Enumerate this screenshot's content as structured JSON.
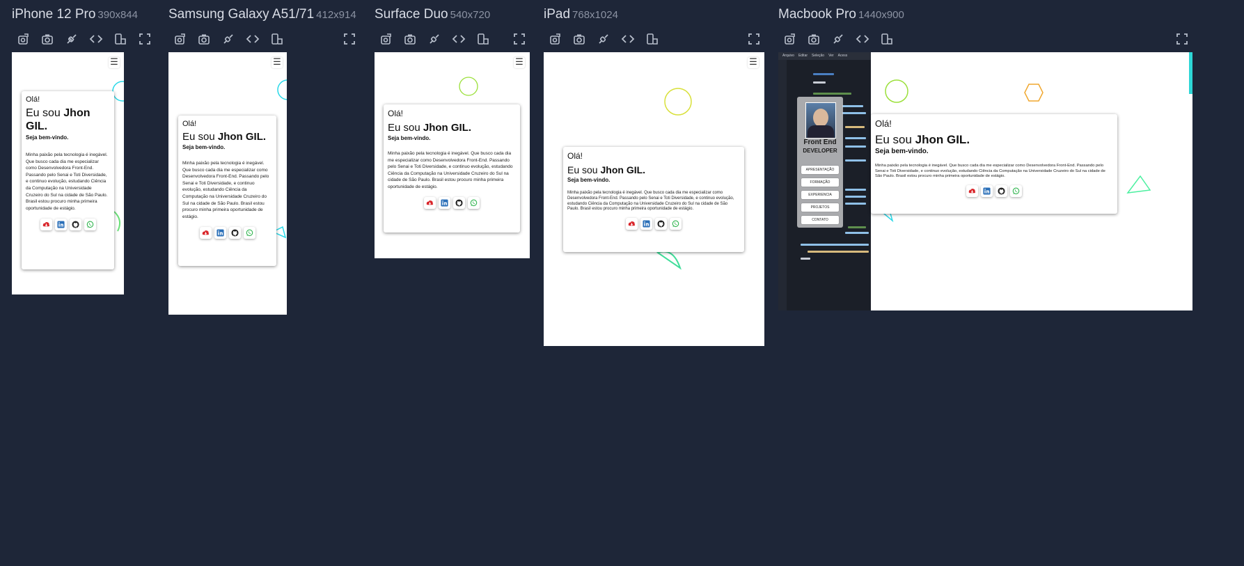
{
  "devices": [
    {
      "name": "iPhone 12 Pro",
      "size": "390x844"
    },
    {
      "name": "Samsung Galaxy A51/71",
      "size": "412x914"
    },
    {
      "name": "Surface Duo",
      "size": "540x720"
    },
    {
      "name": "iPad",
      "size": "768x1024"
    },
    {
      "name": "Macbook Pro",
      "size": "1440x900"
    }
  ],
  "toolbar_icons": [
    "rotate-screen-icon",
    "screenshot-icon",
    "sync-scroll-icon",
    "code-icon",
    "device-layout-icon",
    "fullscreen-icon"
  ],
  "site": {
    "greeting": "Olá!",
    "intro_prefix": "Eu sou ",
    "intro_name": "Jhon GIL.",
    "welcome": "Seja bem-vindo.",
    "bio": "Minha paixão pela tecnologia é inegável. Que busco cada dia me especializar como Desenvolvedora Front-End. Passando pelo Senai e Toti Diversidade, e continuo evolução, estudando Ciência da Computação na Universidade Cruzeiro do Sul na cidade de São Paulo. Brasil estou procuro minha primeira oportunidade de estágio.",
    "menu_icon": "☰",
    "social_icons": [
      "download-cv-icon",
      "linkedin-icon",
      "github-icon",
      "whatsapp-icon"
    ],
    "profile": {
      "title": "Front End",
      "subtitle": "DEVELOPER",
      "nav": [
        "APRESENTAÇÃO",
        "FORMAÇÃO",
        "EXPERIENCIA",
        "PROJETOS",
        "CONTATO"
      ]
    },
    "ide_menu": [
      "Arquivo",
      "Editar",
      "Seleção",
      "Ver",
      "Acess"
    ],
    "colors": {
      "background": "#1e2638",
      "cv": "#d9262b",
      "linkedin": "#2a6fb8",
      "github": "#222222",
      "whatsapp": "#2bb34a",
      "accent": "#2ed6d6"
    }
  }
}
